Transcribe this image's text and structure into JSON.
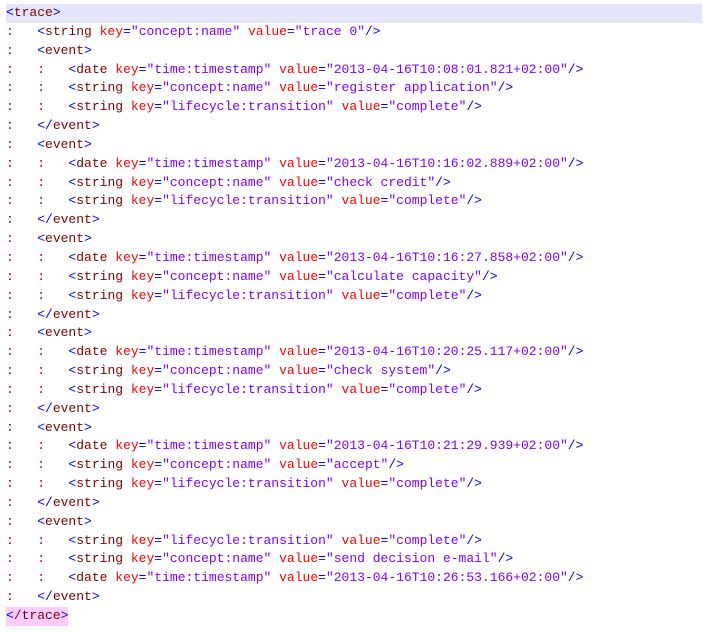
{
  "indent": {
    "l0": "",
    "l1": "    ",
    "l2": "        ",
    "guide1": ":   ",
    "guide2": ":   :   "
  },
  "tags": {
    "trace_open": "trace",
    "trace_close": "/trace",
    "event_open": "event",
    "event_close": "/event",
    "string": "string",
    "date": "date"
  },
  "attrs": {
    "key": "key",
    "value": "value"
  },
  "trace_name": {
    "key": "concept:name",
    "value": "trace 0"
  },
  "events": [
    {
      "lines": [
        {
          "tag": "date",
          "key": "time:timestamp",
          "value": "2013-04-16T10:08:01.821+02:00"
        },
        {
          "tag": "string",
          "key": "concept:name",
          "value": "register application"
        },
        {
          "tag": "string",
          "key": "lifecycle:transition",
          "value": "complete"
        }
      ]
    },
    {
      "lines": [
        {
          "tag": "date",
          "key": "time:timestamp",
          "value": "2013-04-16T10:16:02.889+02:00"
        },
        {
          "tag": "string",
          "key": "concept:name",
          "value": "check credit"
        },
        {
          "tag": "string",
          "key": "lifecycle:transition",
          "value": "complete"
        }
      ]
    },
    {
      "lines": [
        {
          "tag": "date",
          "key": "time:timestamp",
          "value": "2013-04-16T10:16:27.858+02:00"
        },
        {
          "tag": "string",
          "key": "concept:name",
          "value": "calculate capacity"
        },
        {
          "tag": "string",
          "key": "lifecycle:transition",
          "value": "complete"
        }
      ]
    },
    {
      "lines": [
        {
          "tag": "date",
          "key": "time:timestamp",
          "value": "2013-04-16T10:20:25.117+02:00"
        },
        {
          "tag": "string",
          "key": "concept:name",
          "value": "check system"
        },
        {
          "tag": "string",
          "key": "lifecycle:transition",
          "value": "complete"
        }
      ]
    },
    {
      "lines": [
        {
          "tag": "date",
          "key": "time:timestamp",
          "value": "2013-04-16T10:21:29.939+02:00"
        },
        {
          "tag": "string",
          "key": "concept:name",
          "value": "accept"
        },
        {
          "tag": "string",
          "key": "lifecycle:transition",
          "value": "complete"
        }
      ]
    },
    {
      "lines": [
        {
          "tag": "string",
          "key": "lifecycle:transition",
          "value": "complete"
        },
        {
          "tag": "string",
          "key": "concept:name",
          "value": "send decision e-mail"
        },
        {
          "tag": "date",
          "key": "time:timestamp",
          "value": "2013-04-16T10:26:53.166+02:00"
        }
      ]
    }
  ]
}
